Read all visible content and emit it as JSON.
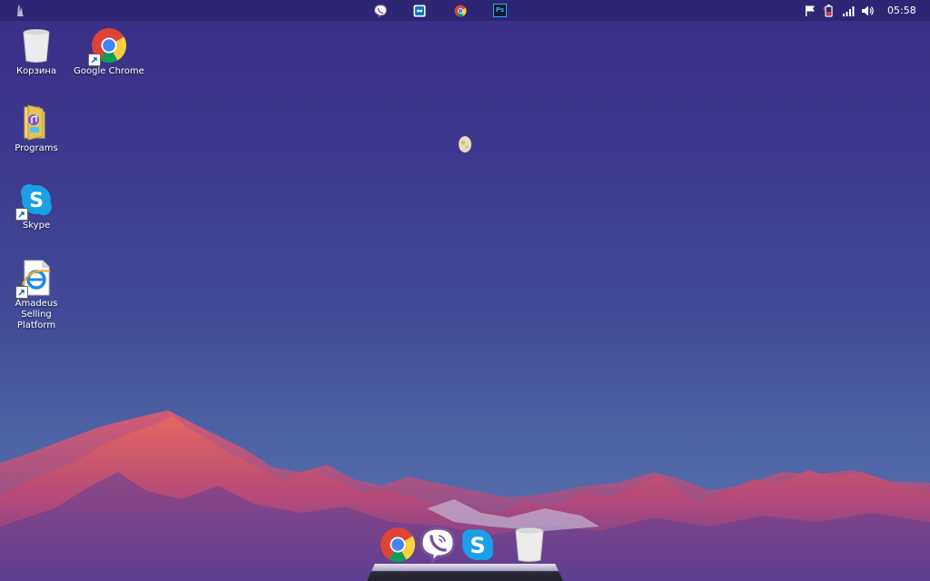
{
  "desktop_icons": [
    {
      "label": "Корзина"
    },
    {
      "label": "Google Chrome"
    },
    {
      "label": "Programs"
    },
    {
      "label": "Skype"
    },
    {
      "label": "Amadeus Selling\nPlatform"
    }
  ],
  "topbar": {
    "launcher_icon": "app-launcher-icon",
    "running_apps": [
      "viber-icon",
      "teamviewer-icon",
      "chrome-icon",
      "photoshop-icon"
    ],
    "photoshop_text": "Ps",
    "tray_icons": [
      "flag-icon",
      "battery-icon",
      "signal-icon",
      "volume-icon"
    ],
    "clock": "05:58"
  },
  "dock": {
    "items": [
      "chrome-icon",
      "viber-icon",
      "skype-icon",
      "trash-icon"
    ]
  },
  "colors": {
    "topbar": "#2e2674",
    "sky_top": "#3a2e86",
    "sky_bottom": "#5a73ad",
    "mountain_light": "#e4675f",
    "skype_blue": "#1aa0e8",
    "viber_purple": "#7b519d"
  }
}
